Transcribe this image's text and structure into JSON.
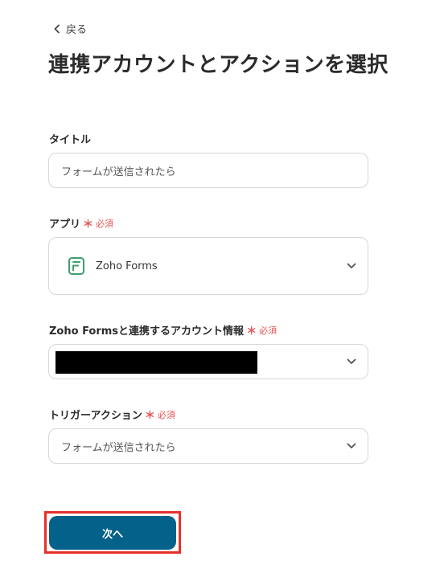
{
  "nav": {
    "back_label": "戻る"
  },
  "page": {
    "title": "連携アカウントとアクションを選択"
  },
  "form": {
    "title_field": {
      "label": "タイトル",
      "value": "フォームが送信されたら"
    },
    "app_field": {
      "label": "アプリ",
      "required_star": "＊",
      "required_text": "必須",
      "value": "Zoho Forms",
      "icon": "zoho-forms-icon"
    },
    "account_field": {
      "label": "Zoho Formsと連携するアカウント情報",
      "required_star": "＊",
      "required_text": "必須"
    },
    "trigger_field": {
      "label": "トリガーアクション",
      "required_star": "＊",
      "required_text": "必須",
      "value": "フォームが送信されたら"
    }
  },
  "actions": {
    "next_label": "次へ"
  },
  "colors": {
    "primary_button": "#04628a",
    "required": "#e65353",
    "highlight": "#e5302a",
    "app_icon": "#3d9f6e"
  }
}
